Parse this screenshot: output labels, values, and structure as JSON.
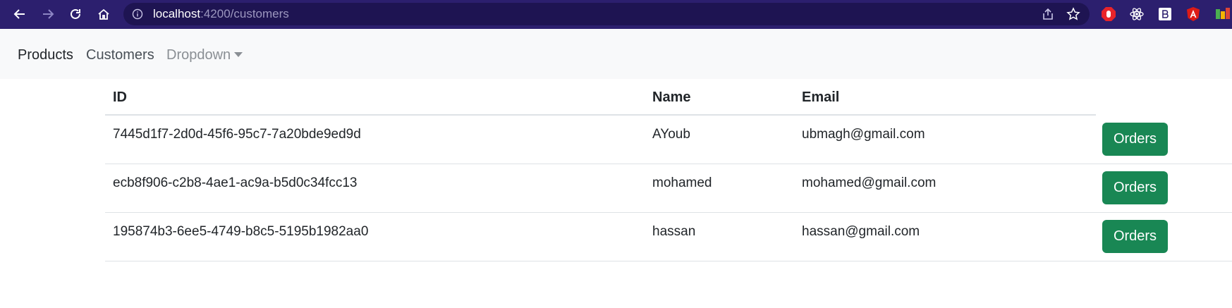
{
  "browser": {
    "url_host": "localhost",
    "url_path": ":4200/customers",
    "accent_color": "#2c1f6e"
  },
  "navbar": {
    "products": "Products",
    "customers": "Customers",
    "dropdown": "Dropdown"
  },
  "table": {
    "headers": {
      "id": "ID",
      "name": "Name",
      "email": "Email"
    },
    "rows": [
      {
        "id": "7445d1f7-2d0d-45f6-95c7-7a20bde9ed9d",
        "name": "AYoub",
        "email": "ubmagh@gmail.com",
        "action": "Orders"
      },
      {
        "id": "ecb8f906-c2b8-4ae1-ac9a-b5d0c34fcc13",
        "name": "mohamed",
        "email": "mohamed@gmail.com",
        "action": "Orders"
      },
      {
        "id": "195874b3-6ee5-4749-b8c5-5195b1982aa0",
        "name": "hassan",
        "email": "hassan@gmail.com",
        "action": "Orders"
      }
    ]
  },
  "colors": {
    "button": "#198754",
    "navbar_bg": "#f8f9fa"
  },
  "icons": {
    "back": "arrow-left-icon",
    "forward": "arrow-right-icon",
    "reload": "reload-icon",
    "home": "home-icon",
    "site_info": "info-icon",
    "share": "share-icon",
    "bookmark": "star-icon"
  }
}
